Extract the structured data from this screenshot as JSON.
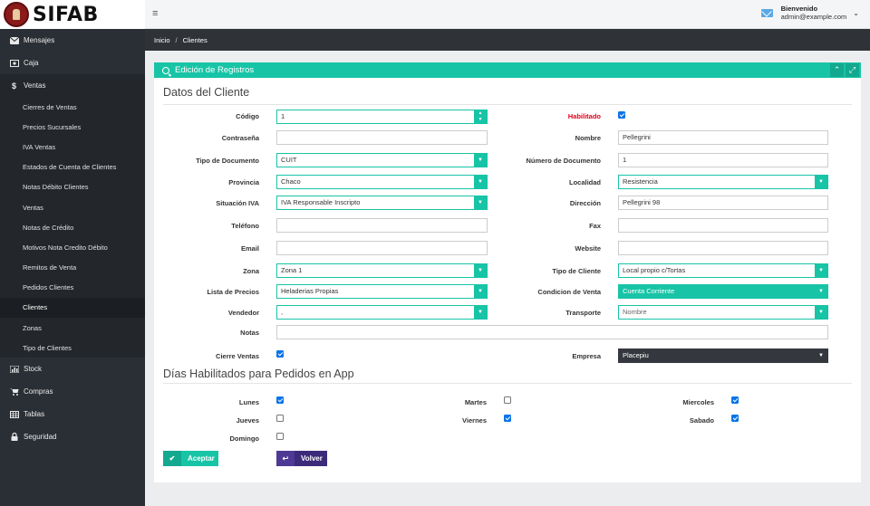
{
  "brand": {
    "logo_text": "SIFAB"
  },
  "sidebar": {
    "items": [
      {
        "label": "Mensajes",
        "icon": "envelope-icon"
      },
      {
        "label": "Caja",
        "icon": "cash-icon"
      },
      {
        "label": "Ventas",
        "icon": "dollar-icon"
      }
    ],
    "ventas_sub": [
      "Cierres de Ventas",
      "Precios Sucursales",
      "IVA Ventas",
      "Estados de Cuenta de Clientes",
      "Notas Débito Clientes",
      "Ventas",
      "Notas de Crédito",
      "Motivos Nota Credito Débito",
      "Remitos de Venta",
      "Pedidos Clientes",
      "Clientes",
      "Zonas",
      "Tipo de Clientes"
    ],
    "bottom_items": [
      {
        "label": "Stock",
        "icon": "chart-icon"
      },
      {
        "label": "Compras",
        "icon": "cart-icon"
      },
      {
        "label": "Tablas",
        "icon": "table-icon"
      },
      {
        "label": "Seguridad",
        "icon": "lock-icon"
      }
    ]
  },
  "topbar": {
    "menu_glyph": "≡",
    "greeting": "Bienvenido",
    "email": "admin@example.com",
    "chevron": "⌄"
  },
  "breadcrumb": {
    "home": "Inicio",
    "separator": "/",
    "current": "Clientes"
  },
  "panel": {
    "title": "Edición de Registros",
    "collapse_glyph": "⌃",
    "expand_glyph": "⤢",
    "section1": "Datos del Cliente",
    "section2": "Días Habilitados para Pedidos en App"
  },
  "form": {
    "codigo": {
      "label": "Código",
      "value": "1"
    },
    "habilitado": {
      "label": "Habilitado",
      "checked": true
    },
    "contrasena": {
      "label": "Contraseña",
      "value": ""
    },
    "nombre": {
      "label": "Nombre",
      "value": "Pellegrini"
    },
    "tipo_documento": {
      "label": "Tipo de Documento",
      "value": "CUIT"
    },
    "numero_documento": {
      "label": "Número de Documento",
      "value": "1"
    },
    "provincia": {
      "label": "Provincia",
      "value": "Chaco"
    },
    "localidad": {
      "label": "Localidad",
      "value": "Resistencia"
    },
    "situacion_iva": {
      "label": "Situación IVA",
      "value": "IVA Responsable Inscripto"
    },
    "direccion": {
      "label": "Dirección",
      "value": "Pellegrini 98"
    },
    "telefono": {
      "label": "Teléfono",
      "value": ""
    },
    "fax": {
      "label": "Fax",
      "value": ""
    },
    "email": {
      "label": "Email",
      "value": ""
    },
    "website": {
      "label": "Website",
      "value": ""
    },
    "zona": {
      "label": "Zona",
      "value": "Zona 1"
    },
    "tipo_cliente": {
      "label": "Tipo de Cliente",
      "value": "Local propio c/Tortas"
    },
    "lista_precios": {
      "label": "Lista de Precios",
      "value": "Heladerias Propias"
    },
    "condicion_venta": {
      "label": "Condicion de Venta",
      "value": "Cuenta Corriente"
    },
    "vendedor": {
      "label": "Vendedor",
      "value": ","
    },
    "transporte": {
      "label": "Transporte",
      "placeholder": "Nombre"
    },
    "notas": {
      "label": "Notas",
      "value": ""
    },
    "cierre_ventas": {
      "label": "Cierre Ventas",
      "checked": true
    },
    "empresa": {
      "label": "Empresa",
      "value": "Placepiu"
    }
  },
  "dias": [
    {
      "label": "Lunes",
      "checked": true
    },
    {
      "label": "Martes",
      "checked": false
    },
    {
      "label": "Miercoles",
      "checked": true
    },
    {
      "label": "Jueves",
      "checked": false
    },
    {
      "label": "Viernes",
      "checked": true
    },
    {
      "label": "Sabado",
      "checked": true
    },
    {
      "label": "Domingo",
      "checked": false
    }
  ],
  "buttons": {
    "accept": "Aceptar",
    "back": "Volver"
  },
  "glyphs": {
    "dropdown": "▼",
    "spin_up": "▲",
    "spin_down": "▼",
    "check": "✔",
    "back": "↩"
  },
  "colors": {
    "accent": "#17c4a6",
    "sidebar": "#2a2f35",
    "danger": "#e0001b",
    "back_button": "#3c2a7a"
  }
}
